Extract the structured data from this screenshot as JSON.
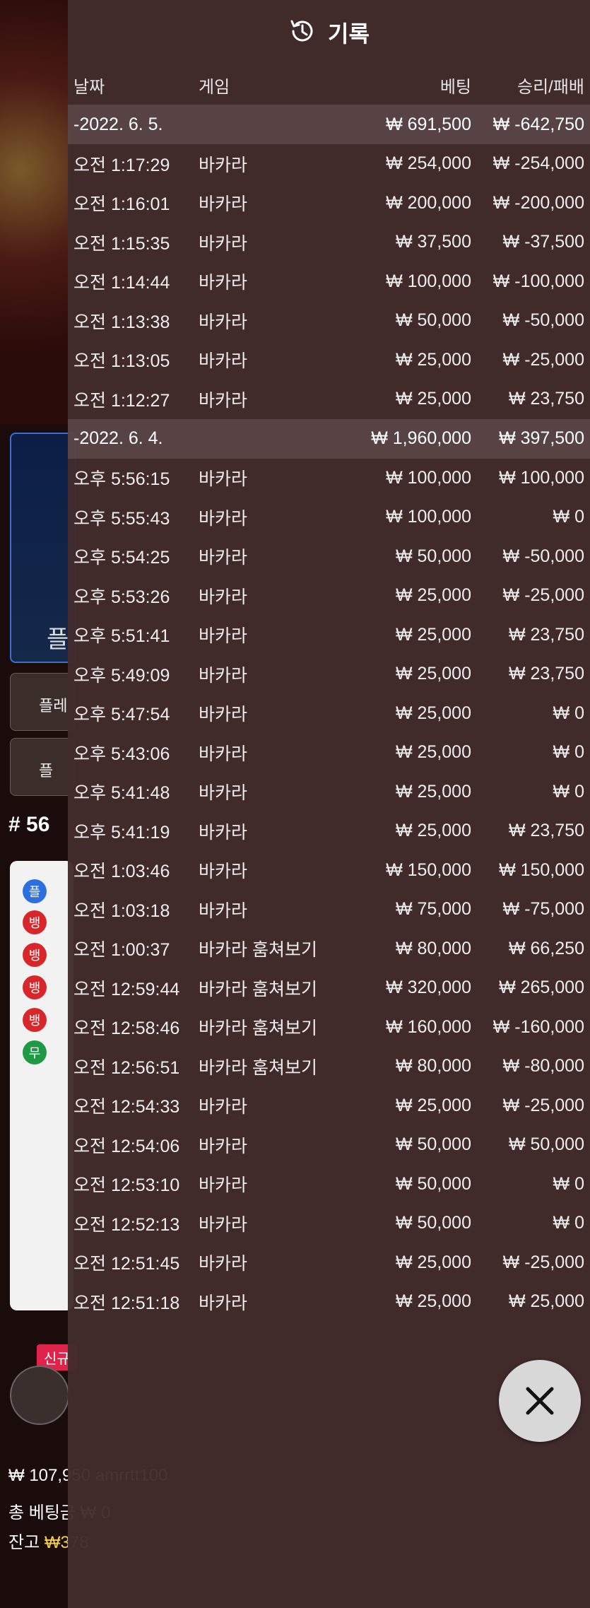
{
  "background": {
    "side_panel_label": "플",
    "buttons": [
      "플레",
      "플"
    ],
    "round_number": "# 56",
    "road_markers": [
      "플",
      "뱅",
      "뱅",
      "뱅",
      "뱅",
      "무"
    ],
    "new_badge": "신규",
    "balance_line": "₩ 107,950 amrrtt100",
    "total_bet_label": "총 베팅금",
    "total_bet_value": "₩ 0",
    "balance_label": "잔고",
    "balance_value": "₩378"
  },
  "history": {
    "title": "기록",
    "columns": {
      "date": "날짜",
      "game": "게임",
      "bet": "베팅",
      "result": "승리/패배"
    },
    "rows": [
      {
        "type": "group",
        "date": "-2022. 6. 5.",
        "bet": "₩ 691,500",
        "result": "₩ -642,750"
      },
      {
        "type": "entry",
        "date": "오전 1:17:29",
        "game": "바카라",
        "bet": "₩ 254,000",
        "result": "₩ -254,000"
      },
      {
        "type": "entry",
        "date": "오전 1:16:01",
        "game": "바카라",
        "bet": "₩ 200,000",
        "result": "₩ -200,000"
      },
      {
        "type": "entry",
        "date": "오전 1:15:35",
        "game": "바카라",
        "bet": "₩ 37,500",
        "result": "₩ -37,500"
      },
      {
        "type": "entry",
        "date": "오전 1:14:44",
        "game": "바카라",
        "bet": "₩ 100,000",
        "result": "₩ -100,000"
      },
      {
        "type": "entry",
        "date": "오전 1:13:38",
        "game": "바카라",
        "bet": "₩ 50,000",
        "result": "₩ -50,000"
      },
      {
        "type": "entry",
        "date": "오전 1:13:05",
        "game": "바카라",
        "bet": "₩ 25,000",
        "result": "₩ -25,000"
      },
      {
        "type": "entry",
        "date": "오전 1:12:27",
        "game": "바카라",
        "bet": "₩ 25,000",
        "result": "₩ 23,750"
      },
      {
        "type": "group",
        "date": "-2022. 6. 4.",
        "bet": "₩ 1,960,000",
        "result": "₩ 397,500"
      },
      {
        "type": "entry",
        "date": "오후 5:56:15",
        "game": "바카라",
        "bet": "₩ 100,000",
        "result": "₩ 100,000"
      },
      {
        "type": "entry",
        "date": "오후 5:55:43",
        "game": "바카라",
        "bet": "₩ 100,000",
        "result": "₩ 0"
      },
      {
        "type": "entry",
        "date": "오후 5:54:25",
        "game": "바카라",
        "bet": "₩ 50,000",
        "result": "₩ -50,000"
      },
      {
        "type": "entry",
        "date": "오후 5:53:26",
        "game": "바카라",
        "bet": "₩ 25,000",
        "result": "₩ -25,000"
      },
      {
        "type": "entry",
        "date": "오후 5:51:41",
        "game": "바카라",
        "bet": "₩ 25,000",
        "result": "₩ 23,750"
      },
      {
        "type": "entry",
        "date": "오후 5:49:09",
        "game": "바카라",
        "bet": "₩ 25,000",
        "result": "₩ 23,750"
      },
      {
        "type": "entry",
        "date": "오후 5:47:54",
        "game": "바카라",
        "bet": "₩ 25,000",
        "result": "₩ 0"
      },
      {
        "type": "entry",
        "date": "오후 5:43:06",
        "game": "바카라",
        "bet": "₩ 25,000",
        "result": "₩ 0"
      },
      {
        "type": "entry",
        "date": "오후 5:41:48",
        "game": "바카라",
        "bet": "₩ 25,000",
        "result": "₩ 0"
      },
      {
        "type": "entry",
        "date": "오후 5:41:19",
        "game": "바카라",
        "bet": "₩ 25,000",
        "result": "₩ 23,750"
      },
      {
        "type": "entry",
        "date": "오전 1:03:46",
        "game": "바카라",
        "bet": "₩ 150,000",
        "result": "₩ 150,000"
      },
      {
        "type": "entry",
        "date": "오전 1:03:18",
        "game": "바카라",
        "bet": "₩ 75,000",
        "result": "₩ -75,000"
      },
      {
        "type": "entry",
        "date": "오전 1:00:37",
        "game": "바카라 훔쳐보기",
        "bet": "₩ 80,000",
        "result": "₩ 66,250"
      },
      {
        "type": "entry",
        "date": "오전 12:59:44",
        "game": "바카라 훔쳐보기",
        "bet": "₩ 320,000",
        "result": "₩ 265,000"
      },
      {
        "type": "entry",
        "date": "오전 12:58:46",
        "game": "바카라 훔쳐보기",
        "bet": "₩ 160,000",
        "result": "₩ -160,000"
      },
      {
        "type": "entry",
        "date": "오전 12:56:51",
        "game": "바카라 훔쳐보기",
        "bet": "₩ 80,000",
        "result": "₩ -80,000"
      },
      {
        "type": "entry",
        "date": "오전 12:54:33",
        "game": "바카라",
        "bet": "₩ 25,000",
        "result": "₩ -25,000"
      },
      {
        "type": "entry",
        "date": "오전 12:54:06",
        "game": "바카라",
        "bet": "₩ 50,000",
        "result": "₩ 50,000"
      },
      {
        "type": "entry",
        "date": "오전 12:53:10",
        "game": "바카라",
        "bet": "₩ 50,000",
        "result": "₩ 0"
      },
      {
        "type": "entry",
        "date": "오전 12:52:13",
        "game": "바카라",
        "bet": "₩ 50,000",
        "result": "₩ 0"
      },
      {
        "type": "entry",
        "date": "오전 12:51:45",
        "game": "바카라",
        "bet": "₩ 25,000",
        "result": "₩ -25,000"
      },
      {
        "type": "entry",
        "date": "오전 12:51:18",
        "game": "바카라",
        "bet": "₩ 25,000",
        "result": "₩ 25,000"
      }
    ]
  },
  "icons": {
    "history": "history-clock-icon",
    "close": "close-icon"
  },
  "colors": {
    "overlay": "#422c2c",
    "group_row": "#5c4646",
    "road_red": "#d9262b",
    "road_blue": "#2c6fe0",
    "road_green": "#1f9a44",
    "gold": "#f7d14a"
  }
}
